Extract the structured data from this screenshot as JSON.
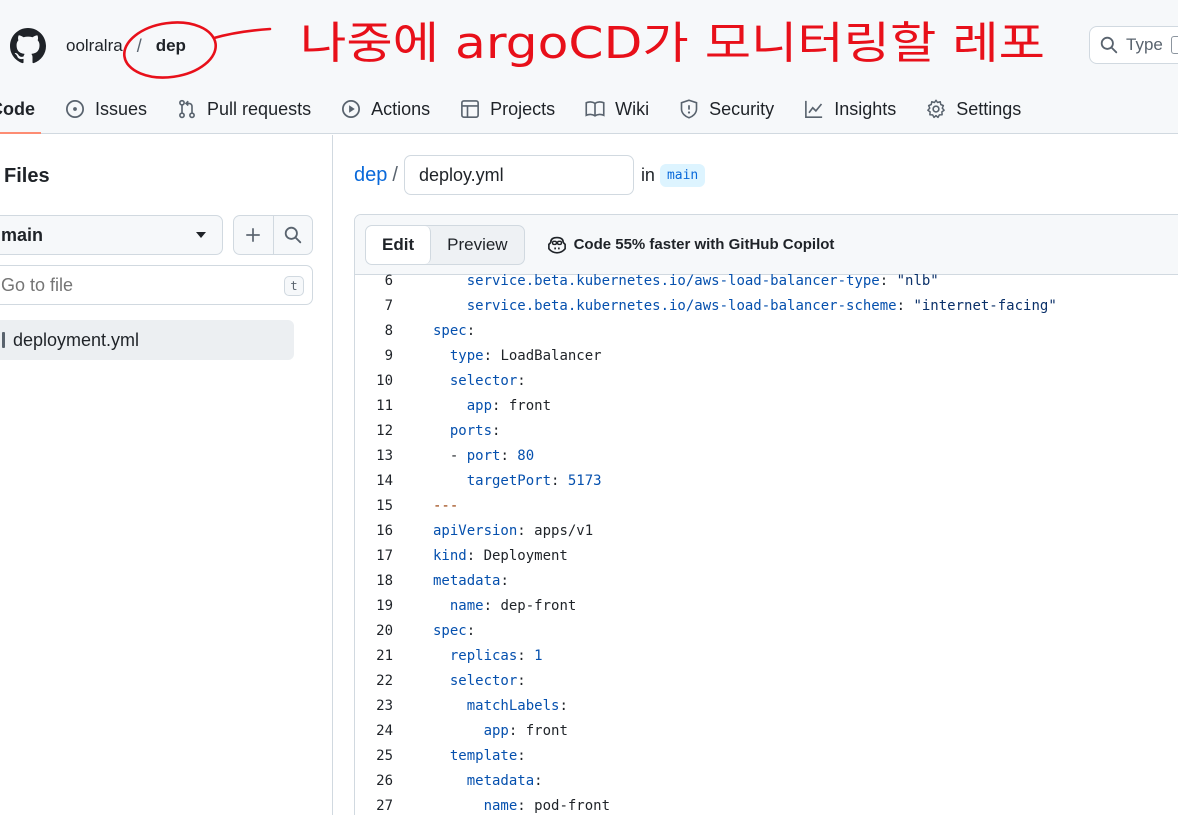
{
  "repo": {
    "owner": "oolralra",
    "separator": "/",
    "name": "dep"
  },
  "annotation": {
    "text": "나중에 argoCD가 모니터링할 레포"
  },
  "search": {
    "placeholder": "Type"
  },
  "nav": [
    {
      "label": "Code",
      "icon": "code-icon",
      "active": true
    },
    {
      "label": "Issues",
      "icon": "issue-icon",
      "active": false
    },
    {
      "label": "Pull requests",
      "icon": "pull-request-icon",
      "active": false
    },
    {
      "label": "Actions",
      "icon": "play-icon",
      "active": false
    },
    {
      "label": "Projects",
      "icon": "table-icon",
      "active": false
    },
    {
      "label": "Wiki",
      "icon": "book-icon",
      "active": false
    },
    {
      "label": "Security",
      "icon": "shield-icon",
      "active": false
    },
    {
      "label": "Insights",
      "icon": "graph-icon",
      "active": false
    },
    {
      "label": "Settings",
      "icon": "gear-icon",
      "active": false
    }
  ],
  "sidebar": {
    "title": "Files",
    "branch": "main",
    "go_to_file_placeholder": "Go to file",
    "go_to_file_key": "t",
    "files": [
      {
        "name": "deployment.yml"
      }
    ]
  },
  "editor": {
    "path_repo": "dep",
    "path_sep": "/",
    "filename": "deploy.yml",
    "in_label": "in",
    "branch": "main",
    "tab_edit": "Edit",
    "tab_preview": "Preview",
    "copilot_text": "Code 55% faster with GitHub Copilot",
    "lines": [
      {
        "n": "6",
        "indent": "    ",
        "key": "service.beta.kubernetes.io/aws-load-balancer-type",
        "sep": ": ",
        "value": "\"nlb\"",
        "vtype": "str"
      },
      {
        "n": "7",
        "indent": "    ",
        "key": "service.beta.kubernetes.io/aws-load-balancer-scheme",
        "sep": ": ",
        "value": "\"internet-facing\"",
        "vtype": "str"
      },
      {
        "n": "8",
        "indent": "",
        "key": "spec",
        "sep": ":",
        "value": "",
        "vtype": "plain"
      },
      {
        "n": "9",
        "indent": "  ",
        "key": "type",
        "sep": ": ",
        "value": "LoadBalancer",
        "vtype": "plain"
      },
      {
        "n": "10",
        "indent": "  ",
        "key": "selector",
        "sep": ":",
        "value": "",
        "vtype": "plain"
      },
      {
        "n": "11",
        "indent": "    ",
        "key": "app",
        "sep": ": ",
        "value": "front",
        "vtype": "plain"
      },
      {
        "n": "12",
        "indent": "  ",
        "key": "ports",
        "sep": ":",
        "value": "",
        "vtype": "plain"
      },
      {
        "n": "13",
        "indent": "  - ",
        "key": "port",
        "sep": ": ",
        "value": "80",
        "vtype": "num"
      },
      {
        "n": "14",
        "indent": "    ",
        "key": "targetPort",
        "sep": ": ",
        "value": "5173",
        "vtype": "num"
      },
      {
        "n": "15",
        "indent": "",
        "key": "",
        "sep": "",
        "value": "---",
        "vtype": "doc"
      },
      {
        "n": "16",
        "indent": "",
        "key": "apiVersion",
        "sep": ": ",
        "value": "apps/v1",
        "vtype": "plain"
      },
      {
        "n": "17",
        "indent": "",
        "key": "kind",
        "sep": ": ",
        "value": "Deployment",
        "vtype": "plain"
      },
      {
        "n": "18",
        "indent": "",
        "key": "metadata",
        "sep": ":",
        "value": "",
        "vtype": "plain"
      },
      {
        "n": "19",
        "indent": "  ",
        "key": "name",
        "sep": ": ",
        "value": "dep-front",
        "vtype": "plain"
      },
      {
        "n": "20",
        "indent": "",
        "key": "spec",
        "sep": ":",
        "value": "",
        "vtype": "plain"
      },
      {
        "n": "21",
        "indent": "  ",
        "key": "replicas",
        "sep": ": ",
        "value": "1",
        "vtype": "num"
      },
      {
        "n": "22",
        "indent": "  ",
        "key": "selector",
        "sep": ":",
        "value": "",
        "vtype": "plain"
      },
      {
        "n": "23",
        "indent": "    ",
        "key": "matchLabels",
        "sep": ":",
        "value": "",
        "vtype": "plain"
      },
      {
        "n": "24",
        "indent": "      ",
        "key": "app",
        "sep": ": ",
        "value": "front",
        "vtype": "plain"
      },
      {
        "n": "25",
        "indent": "  ",
        "key": "template",
        "sep": ":",
        "value": "",
        "vtype": "plain"
      },
      {
        "n": "26",
        "indent": "    ",
        "key": "metadata",
        "sep": ":",
        "value": "",
        "vtype": "plain"
      },
      {
        "n": "27",
        "indent": "      ",
        "key": "name",
        "sep": ": ",
        "value": "pod-front",
        "vtype": "plain"
      }
    ]
  },
  "colors": {
    "link": "#0969da",
    "annotation_red": "#e8101a",
    "active_tab_underline": "#fd8c73",
    "yaml_key": "#0550ae",
    "yaml_string": "#0a3069"
  }
}
